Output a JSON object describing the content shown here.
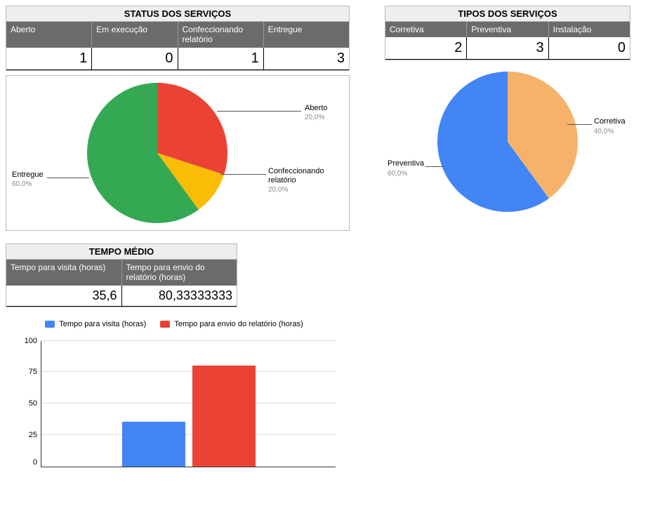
{
  "status": {
    "title": "STATUS DOS SERVIÇOS",
    "headers": [
      "Aberto",
      "Em execução",
      "Confeccionando relatório",
      "Entregue"
    ],
    "values": [
      "1",
      "0",
      "1",
      "3"
    ],
    "labels": {
      "aberto": "Aberto",
      "aberto_pct": "20,0%",
      "conf": "Confeccionando relatório",
      "conf_pct": "20,0%",
      "entregue": "Entregue",
      "entregue_pct": "60,0%"
    }
  },
  "tipos": {
    "title": "TIPOS DOS SERVIÇOS",
    "headers": [
      "Corretiva",
      "Preventiva",
      "Instalação"
    ],
    "values": [
      "2",
      "3",
      "0"
    ],
    "labels": {
      "corretiva": "Corretiva",
      "corretiva_pct": "40,0%",
      "preventiva": "Preventiva",
      "preventiva_pct": "60,0%"
    }
  },
  "tempo": {
    "title": "TEMPO MÉDIO",
    "headers": [
      "Tempo para visita (horas)",
      "Tempo para envio do relatório (horas)"
    ],
    "values": [
      "35,6",
      "80,33333333"
    ],
    "legend": [
      "Tempo para visita (horas)",
      "Tempo para envio do relatório (horas)"
    ],
    "yticks": [
      "0",
      "25",
      "50",
      "75",
      "100"
    ]
  },
  "colors": {
    "green": "#34a853",
    "red": "#ea4335",
    "yellow": "#fbbc05",
    "blue": "#4285f4",
    "orange": "#f6b26b"
  },
  "chart_data": [
    {
      "type": "pie",
      "title": "STATUS DOS SERVIÇOS",
      "series": [
        {
          "name": "Aberto",
          "value": 1,
          "pct": 20.0
        },
        {
          "name": "Confeccionando relatório",
          "value": 1,
          "pct": 20.0
        },
        {
          "name": "Entregue",
          "value": 3,
          "pct": 60.0
        }
      ]
    },
    {
      "type": "pie",
      "title": "TIPOS DOS SERVIÇOS",
      "series": [
        {
          "name": "Corretiva",
          "value": 2,
          "pct": 40.0
        },
        {
          "name": "Preventiva",
          "value": 3,
          "pct": 60.0
        }
      ]
    },
    {
      "type": "bar",
      "title": "TEMPO MÉDIO",
      "categories": [
        "Tempo para visita (horas)",
        "Tempo para envio do relatório (horas)"
      ],
      "values": [
        35.6,
        80.33333333
      ],
      "ylim": [
        0,
        100
      ],
      "xlabel": "",
      "ylabel": ""
    }
  ]
}
